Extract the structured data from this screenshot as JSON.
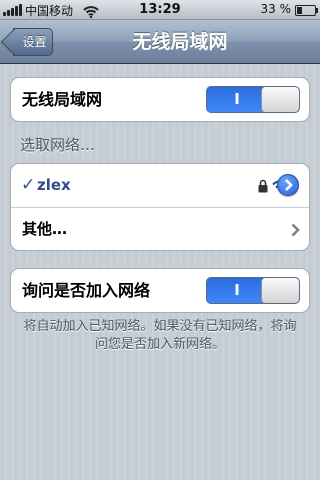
{
  "status_bar": {
    "carrier": "中国移动",
    "time": "13:29",
    "battery_percent": "33 %",
    "battery_level": 0.33,
    "signal_icon": "signal-bars-icon",
    "wifi_icon": "wifi-icon"
  },
  "nav": {
    "back_label": "设置",
    "title": "无线局域网"
  },
  "wifi_toggle": {
    "label": "无线局域网",
    "switch_on_label": "I",
    "state": "on"
  },
  "networks_section": {
    "header": "选取网络…",
    "networks": [
      {
        "name": "zlex",
        "selected": true,
        "secured": true,
        "icons": [
          "checkmark-icon",
          "lock-icon",
          "wifi-signal-icon",
          "detail-disclosure-icon"
        ]
      }
    ],
    "other_label": "其他…"
  },
  "ask_join": {
    "label": "询问是否加入网络",
    "switch_on_label": "I",
    "state": "on",
    "note": "将自动加入已知网络。如果没有已知网络，将询问您是否加入新网络。"
  },
  "colors": {
    "accent_blue": "#3f86f7",
    "selected_text": "#324f85",
    "navbar": "#6c809c"
  }
}
